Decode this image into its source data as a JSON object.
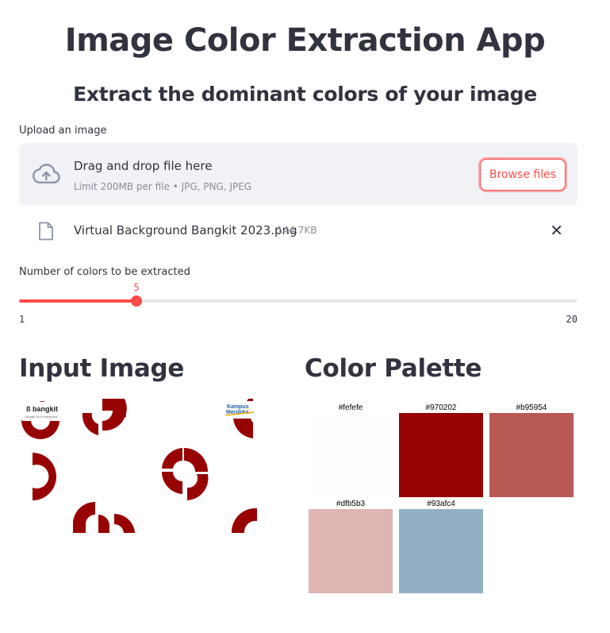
{
  "page": {
    "title": "Image Color Extraction App",
    "subtitle": "Extract the dominant colors of your image"
  },
  "uploader": {
    "label": "Upload an image",
    "drop_text": "Drag and drop file here",
    "limit_text": "Limit 200MB per file • JPG, PNG, JPEG",
    "browse_label": "Browse files",
    "icon": "cloud-upload-icon"
  },
  "uploaded_file": {
    "name": "Virtual Background Bangkit 2023.png",
    "size": "144.7KB",
    "icon": "file-icon",
    "remove_icon": "close-icon",
    "remove_glyph": "✕"
  },
  "slider": {
    "label": "Number of colors to be extracted",
    "value": "5",
    "min": "1",
    "max": "20",
    "fraction": 0.2105,
    "accent": "#ff4b4b"
  },
  "input_section": {
    "heading": "Input Image",
    "logo_left": "bangkit",
    "logo_left_sub": "Google · GoTo · traveloka",
    "logo_right_line1": "Kampus",
    "logo_right_line2": "Merdeka",
    "motif_color": "#970202"
  },
  "palette_section": {
    "heading": "Color Palette",
    "colors": [
      {
        "label": "#fefefe",
        "hex": "#fefefe"
      },
      {
        "label": "#970202",
        "hex": "#970202"
      },
      {
        "label": "#b95954",
        "hex": "#b95954"
      },
      {
        "label": "#dfb5b3",
        "hex": "#dfb5b3"
      },
      {
        "label": "#93afc4",
        "hex": "#93afc4"
      }
    ]
  }
}
